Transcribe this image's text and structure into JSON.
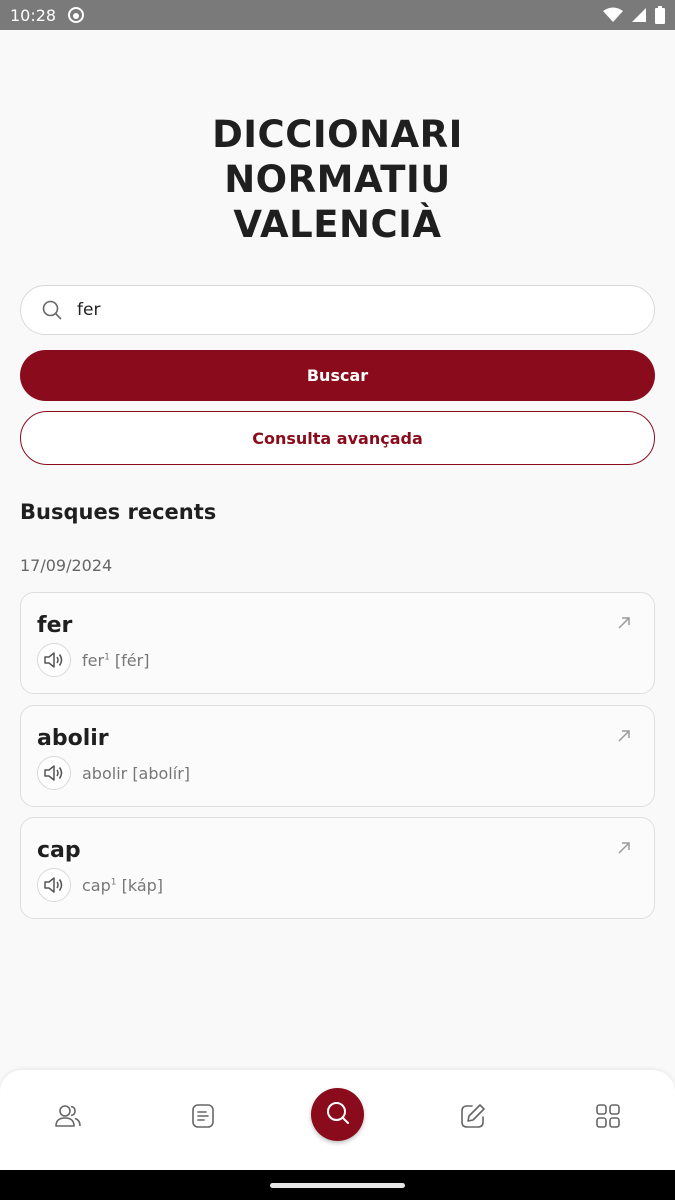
{
  "status_bar": {
    "time": "10:28"
  },
  "title_lines": [
    "DICCIONARI",
    "NORMATIU",
    "VALENCIÀ"
  ],
  "search": {
    "value": "fer",
    "icon": "search-icon"
  },
  "buttons": {
    "search_label": "Buscar",
    "advanced_label": "Consulta avançada"
  },
  "recent": {
    "heading": "Busques recents",
    "date": "17/09/2024",
    "items": [
      {
        "word": "fer",
        "pron_word": "fer",
        "sup": "1",
        "ipa": "[fér]"
      },
      {
        "word": "abolir",
        "pron_word": "abolir",
        "sup": "",
        "ipa": "[abolír]"
      },
      {
        "word": "cap",
        "pron_word": "cap",
        "sup": "1",
        "ipa": "[káp]"
      }
    ]
  },
  "bottom_nav": {
    "items": [
      "people-icon",
      "document-icon",
      "search-icon",
      "edit-icon",
      "grid-icon"
    ],
    "active": "search-icon"
  },
  "colors": {
    "accent": "#8a0c1c",
    "background": "#f9f9f9"
  }
}
